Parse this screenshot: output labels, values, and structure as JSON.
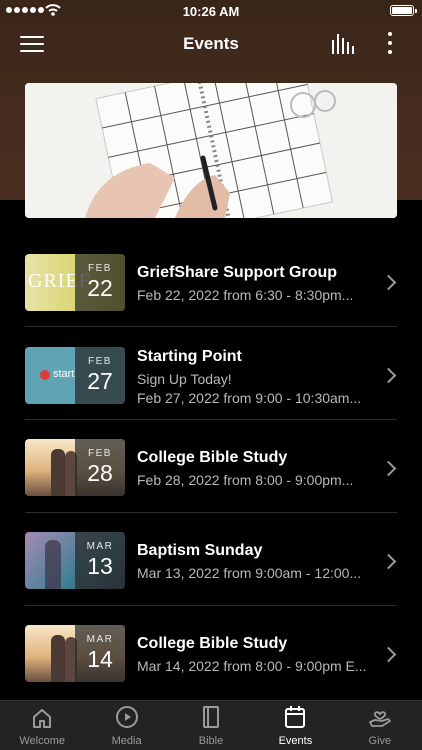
{
  "status": {
    "time": "10:26 AM"
  },
  "nav": {
    "title": "Events"
  },
  "events": [
    {
      "title": "GriefShare Support Group",
      "subtitle": "Feb 22, 2022 from 6:30 - 8:30pm...",
      "month": "FEB",
      "day": "22",
      "thumb_text": "GRIEF"
    },
    {
      "title": "Starting Point",
      "subtitle": "Sign Up Today!",
      "subtitle2": "Feb 27, 2022 from 9:00 - 10:30am...",
      "month": "FEB",
      "day": "27",
      "thumb_text": "start"
    },
    {
      "title": "College Bible Study",
      "subtitle": "Feb 28, 2022 from 8:00 - 9:00pm...",
      "month": "FEB",
      "day": "28"
    },
    {
      "title": "Baptism Sunday",
      "subtitle": "Mar 13, 2022 from 9:00am - 12:00...",
      "month": "MAR",
      "day": "13"
    },
    {
      "title": "College Bible Study",
      "subtitle": "Mar 14, 2022 from 8:00 - 9:00pm E...",
      "month": "MAR",
      "day": "14"
    }
  ],
  "tabs": [
    {
      "label": "Welcome",
      "icon": "home-icon"
    },
    {
      "label": "Media",
      "icon": "play-icon"
    },
    {
      "label": "Bible",
      "icon": "book-icon"
    },
    {
      "label": "Events",
      "icon": "calendar-icon",
      "active": true
    },
    {
      "label": "Give",
      "icon": "give-icon"
    }
  ]
}
